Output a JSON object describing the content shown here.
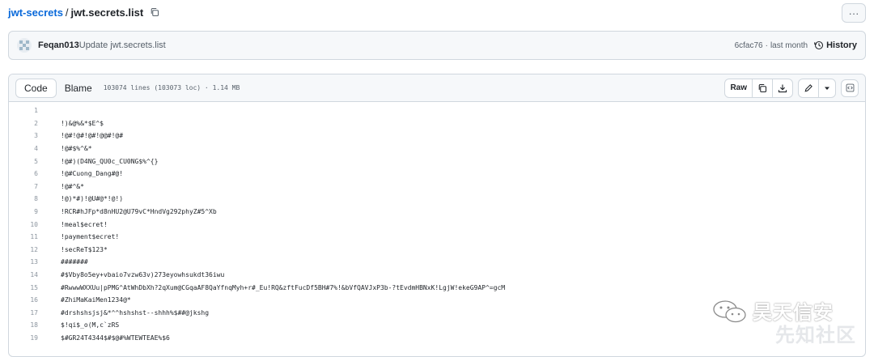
{
  "breadcrumb": {
    "repo": "jwt-secrets",
    "separator": "/",
    "file": "jwt.secrets.list"
  },
  "more_label": "···",
  "commit": {
    "author": "Feqan013",
    "message": "Update jwt.secrets.list",
    "sha": "6cfac76",
    "separator": "·",
    "time": "last month",
    "history_label": "History"
  },
  "file_header": {
    "tab_code": "Code",
    "tab_blame": "Blame",
    "info": "103074 lines (103073 loc) · 1.14 MB",
    "raw_label": "Raw"
  },
  "code_lines": [
    {
      "n": "1",
      "t": ""
    },
    {
      "n": "2",
      "t": "!)&@%&*$E^$"
    },
    {
      "n": "3",
      "t": "!@#!@#!@#!@@#!@#"
    },
    {
      "n": "4",
      "t": "!@#$%^&*"
    },
    {
      "n": "5",
      "t": "!@#)(D4NG_QU0c_CU0NG$%^{}"
    },
    {
      "n": "6",
      "t": "!@#Cuong_Dang#@!"
    },
    {
      "n": "7",
      "t": "!@#^&*"
    },
    {
      "n": "8",
      "t": "!@)*#)!@U#@*!@!)"
    },
    {
      "n": "9",
      "t": "!RCR#hJFp*d8nHU2@U79vC*HndVg292phyZ#5^Xb"
    },
    {
      "n": "10",
      "t": "!meal$ecret!"
    },
    {
      "n": "11",
      "t": "!payment$ecret!"
    },
    {
      "n": "12",
      "t": "!secReT$123*"
    },
    {
      "n": "13",
      "t": "#######"
    },
    {
      "n": "14",
      "t": "#$Vby8o5ey+vbaio7vzw63v)273eyowhsukdt36iwu"
    },
    {
      "n": "15",
      "t": "#RwwwWXXUu|pPMG^AtWhDbXh?2qXum@CGqaAF8QaYfnqMyh+r#_Eu!RQ&zftFucDf5BH#7%!&bVfQAVJxP3b-?tEvdmHBNxK!LgjW!ekeG9AP^=gcM"
    },
    {
      "n": "16",
      "t": "#ZhiMaKaiMen1234@*"
    },
    {
      "n": "17",
      "t": "#drshshsjsj&*^^hshshst--shhh%$##@jkshg"
    },
    {
      "n": "18",
      "t": "$!qi$_o(M,c`zRS"
    },
    {
      "n": "19",
      "t": "$#GR24T4344$#$@#%WTEWTEAE%$6"
    }
  ],
  "watermark": {
    "line1": "昊天信安",
    "line2": "先知社区"
  },
  "icons": {
    "copy": "copy-icon",
    "history": "history-icon",
    "download": "download-icon",
    "edit": "pencil-icon",
    "dropdown": "triangle-down-icon",
    "symbols": "code-square-icon"
  }
}
